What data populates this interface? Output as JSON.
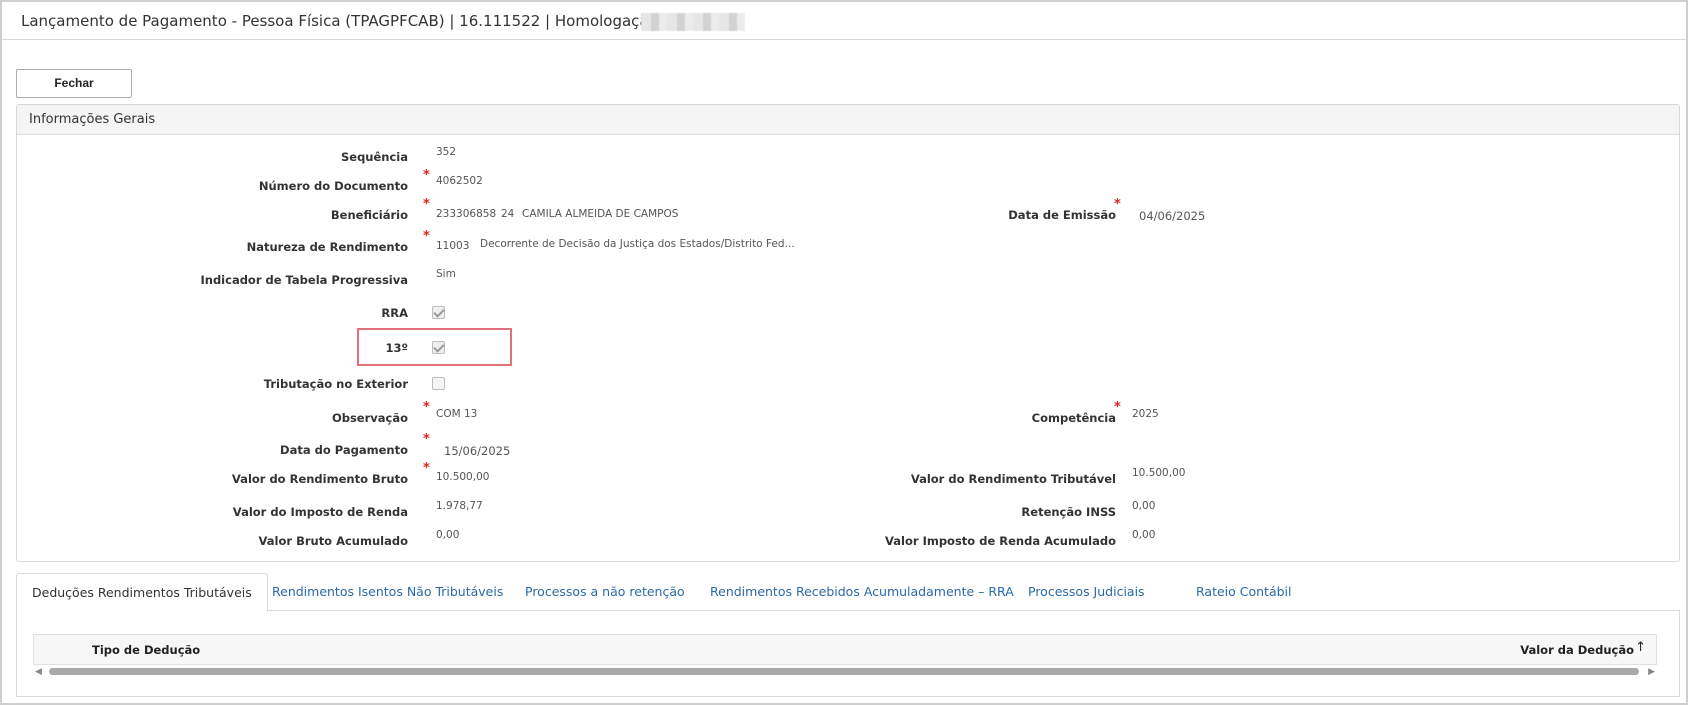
{
  "window": {
    "title": "Lançamento de Pagamento - Pessoa Física (TPAGPFCAB) | 16.111522 | Homologação |"
  },
  "toolbar": {
    "close_label": "Fechar"
  },
  "panel": {
    "title": "Informações Gerais"
  },
  "fields": {
    "sequencia": {
      "label": "Sequência",
      "value": "352"
    },
    "numero_documento": {
      "label": "Número do Documento",
      "value": "4062502"
    },
    "beneficiario": {
      "label": "Beneficiário",
      "code": "233306858",
      "digit": "24",
      "name": "CAMILA ALMEIDA DE CAMPOS"
    },
    "data_emissao": {
      "label": "Data de Emissão",
      "value": "04/06/2025"
    },
    "natureza_rendimento": {
      "label": "Natureza de Rendimento",
      "code": "11003",
      "description": "Decorrente de Decisão da Justiça dos Estados/Distrito Fed..."
    },
    "indicador_tabela": {
      "label": "Indicador de Tabela Progressiva",
      "value": "Sim"
    },
    "rra": {
      "label": "RRA",
      "checked": true
    },
    "decimo_terceiro": {
      "label": "13º",
      "checked": true
    },
    "tributacao_exterior": {
      "label": "Tributação no Exterior",
      "checked": false
    },
    "observacao": {
      "label": "Observação",
      "value": "COM 13"
    },
    "competencia": {
      "label": "Competência",
      "value": "2025"
    },
    "data_pagamento": {
      "label": "Data do Pagamento",
      "value": "15/06/2025"
    },
    "valor_rendimento_bruto": {
      "label": "Valor do Rendimento Bruto",
      "value": "10.500,00"
    },
    "valor_rendimento_tributavel": {
      "label": "Valor do Rendimento Tributável",
      "value": "10.500,00"
    },
    "valor_imposto_renda": {
      "label": "Valor do Imposto de Renda",
      "value": "1.978,77"
    },
    "retencao_inss": {
      "label": "Retenção INSS",
      "value": "0,00"
    },
    "valor_bruto_acumulado": {
      "label": "Valor Bruto Acumulado",
      "value": "0,00"
    },
    "valor_ir_acumulado": {
      "label": "Valor Imposto de Renda Acumulado",
      "value": "0,00"
    }
  },
  "required_mark": "*",
  "tabs": [
    {
      "label": "Deduções Rendimentos Tributáveis",
      "active": true
    },
    {
      "label": "Rendimentos Isentos Não Tributáveis",
      "active": false
    },
    {
      "label": "Processos a não retenção",
      "active": false
    },
    {
      "label": "Rendimentos Recebidos Acumuladamente – RRA",
      "active": false
    },
    {
      "label": "Processos Judiciais",
      "active": false
    },
    {
      "label": "Rateio Contábil",
      "active": false
    }
  ],
  "grid": {
    "columns": [
      "Tipo de Dedução",
      "Valor da Dedução"
    ],
    "sort_icon": "arrow-up-icon",
    "rows": []
  },
  "colors": {
    "required": "#e02020",
    "link": "#2a6aa8",
    "highlight": "#e0707a"
  }
}
